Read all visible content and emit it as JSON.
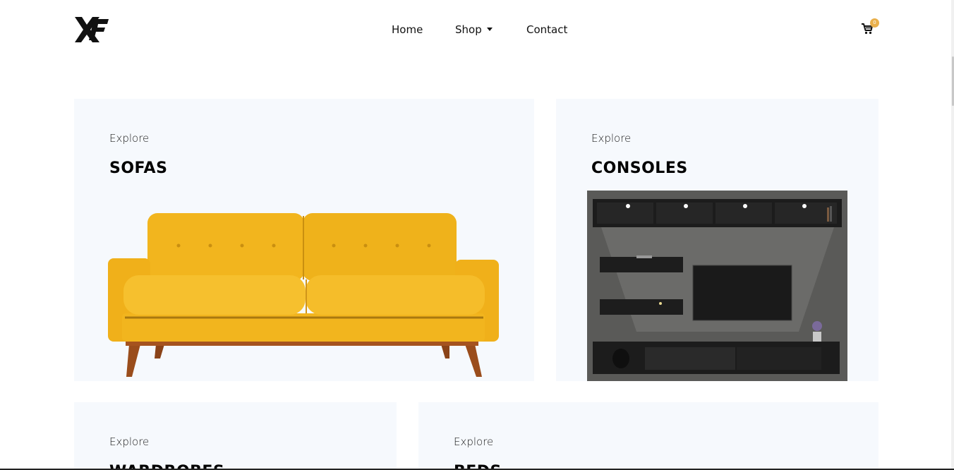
{
  "header": {
    "logo_text": "XF",
    "nav": {
      "home": "Home",
      "shop": "Shop",
      "contact": "Contact"
    },
    "cart": {
      "count": "0"
    }
  },
  "cards": {
    "sofas": {
      "kicker": "Explore",
      "title": "SOFAS"
    },
    "consoles": {
      "kicker": "Explore",
      "title": "CONSOLES"
    },
    "wardrobes": {
      "kicker": "Explore",
      "title": "WARDROBES"
    },
    "beds": {
      "kicker": "Explore",
      "title": "BEDS"
    }
  },
  "colors": {
    "card_bg": "#f6f9fd",
    "badge": "#e9b04c",
    "sofa": "#f2b51e",
    "sofa_legs": "#9a4d1c"
  },
  "icons": {
    "cart": "cart-icon",
    "caret": "chevron-down-icon"
  }
}
